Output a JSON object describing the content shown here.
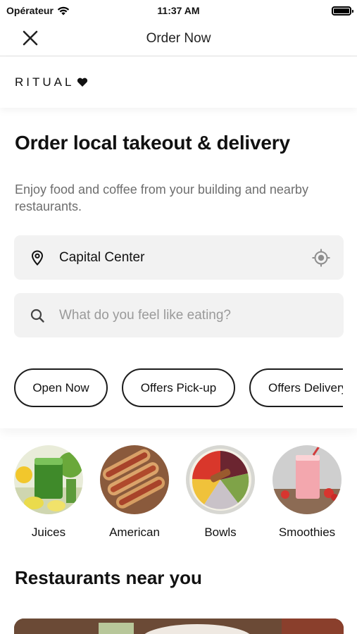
{
  "status_bar": {
    "carrier": "Opérateur",
    "time": "11:37 AM"
  },
  "nav": {
    "title": "Order Now"
  },
  "brand": {
    "name": "RITUAL"
  },
  "hero": {
    "title": "Order local takeout & delivery",
    "subtitle": "Enjoy food and coffee from your building and nearby restaurants."
  },
  "location": {
    "value": "Capital Center"
  },
  "search": {
    "placeholder": "What do you feel like eating?"
  },
  "filters": [
    {
      "label": "Open Now"
    },
    {
      "label": "Offers Pick-up"
    },
    {
      "label": "Offers Delivery"
    }
  ],
  "categories": [
    {
      "label": "Juices",
      "icon": "juice-image"
    },
    {
      "label": "American",
      "icon": "hotdog-image"
    },
    {
      "label": "Bowls",
      "icon": "bowl-image"
    },
    {
      "label": "Smoothies",
      "icon": "smoothie-image"
    }
  ],
  "restaurants_section": {
    "title": "Restaurants near you"
  },
  "colors": {
    "text": "#111111",
    "muted": "#6e6e6e",
    "field_bg": "#f2f2f2",
    "chip_border": "#1d1d1d"
  }
}
